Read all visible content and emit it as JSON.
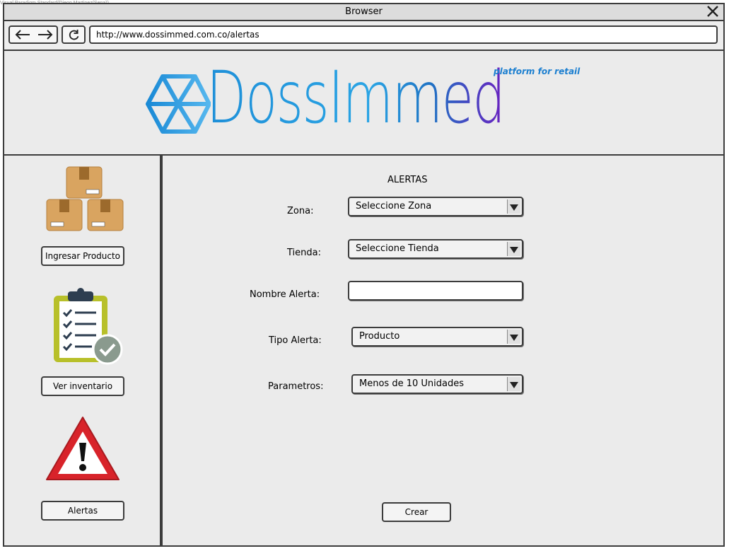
{
  "watermark": "Visual Paradigm Standard(Diego Martinez(Sena))",
  "window": {
    "title": "Browser"
  },
  "toolbar": {
    "url": "http://www.dossimmed.com.co/alertas"
  },
  "banner": {
    "brand": "DossImmed",
    "tagline": "platform for retail"
  },
  "sidebar": {
    "items": [
      {
        "label": "Ingresar Producto",
        "icon": "boxes-icon"
      },
      {
        "label": "Ver inventario",
        "icon": "clipboard-checklist-icon"
      },
      {
        "label": "Alertas",
        "icon": "warning-icon"
      }
    ]
  },
  "form": {
    "title": "ALERTAS",
    "zona": {
      "label": "Zona:",
      "value": "Seleccione Zona"
    },
    "tienda": {
      "label": "Tienda:",
      "value": "Seleccione Tienda"
    },
    "nombre": {
      "label": "Nombre Alerta:",
      "value": ""
    },
    "tipo": {
      "label": "Tipo Alerta:",
      "value": "Producto"
    },
    "parametros": {
      "label": "Parametros:",
      "value": "Menos de 10 Unidades"
    },
    "submit": "Crear"
  },
  "colors": {
    "brand_blue": "#1e8fd8",
    "brand_purple": "#6a1fc0",
    "warning_red": "#d8232a"
  }
}
